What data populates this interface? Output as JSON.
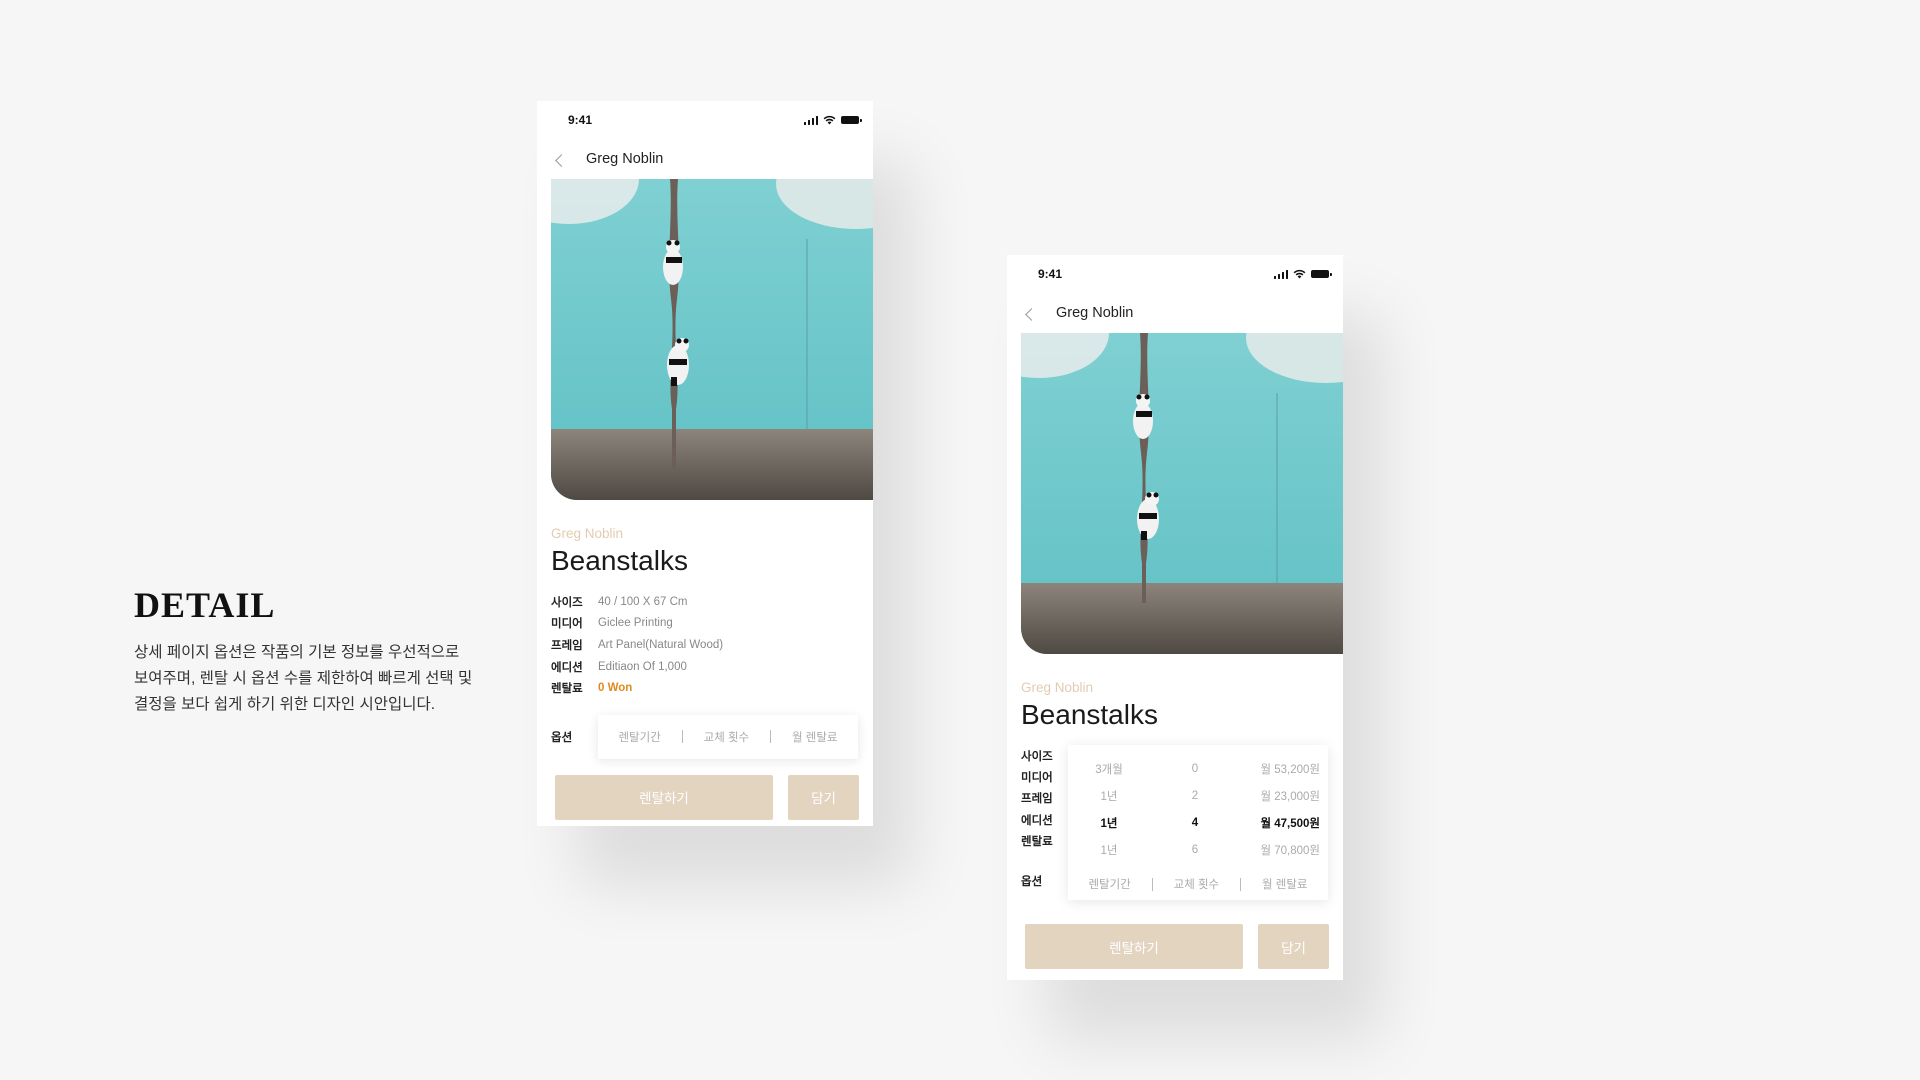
{
  "intro": {
    "heading": "DETAIL",
    "description": "상세 페이지 옵션은 작품의 기본 정보를 우선적으로 보여주며, 렌탈 시 옵션 수를 제한하여 빠르게 선택 및 결정을 보다 쉽게 하기 위한 디자인 시안입니다."
  },
  "phone1": {
    "time": "9:41",
    "nav_title": "Greg Noblin",
    "artist": "Greg Noblin",
    "title": "Beanstalks",
    "spec": [
      {
        "label": "사이즈",
        "value": "40 / 100 X 67 Cm"
      },
      {
        "label": "미디어",
        "value": "Giclee Printing"
      },
      {
        "label": "프레임",
        "value": "Art Panel(Natural Wood)"
      },
      {
        "label": "에디션",
        "value": "Editiaon Of 1,000"
      },
      {
        "label": "렌탈료",
        "value": "0 Won"
      }
    ],
    "options_label": "옵션",
    "options": [
      "렌탈기간",
      "교체 횟수",
      "월 렌탈료"
    ],
    "rent_button": "렌탈하기",
    "cart_button": "담기"
  },
  "phone2": {
    "time": "9:41",
    "nav_title": "Greg Noblin",
    "artist": "Greg Noblin",
    "title": "Beanstalks",
    "spec_labels": [
      "사이즈",
      "미디어",
      "프레임",
      "에디션",
      "렌탈료"
    ],
    "options_label": "옵션",
    "dropdown_rows": [
      {
        "period": "3개월",
        "swaps": "0",
        "fee": "월 53,200원"
      },
      {
        "period": "1년",
        "swaps": "2",
        "fee": "월 23,000원"
      },
      {
        "period": "1년",
        "swaps": "4",
        "fee": "월 47,500원",
        "selected": true
      },
      {
        "period": "1년",
        "swaps": "6",
        "fee": "월 70,800원"
      }
    ],
    "options": [
      "렌탈기간",
      "교체 횟수",
      "월 렌탈료"
    ],
    "rent_button": "렌탈하기",
    "cart_button": "담기"
  },
  "colors": {
    "accent_beige": "#e3d4c0",
    "artist_text": "#e2ccb1",
    "price_orange": "#e08a1e",
    "sky": "#6cc9cc"
  }
}
